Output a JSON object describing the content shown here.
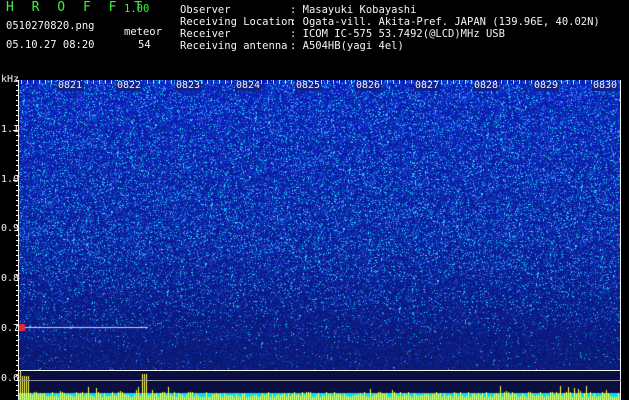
{
  "header": {
    "app_title": "H R O F F T",
    "app_version": "1.00",
    "file_name": "0510270820.png",
    "timestamp": "05.10.27 08:20",
    "meteor_label": "meteor",
    "meteor_count": "54"
  },
  "info": [
    {
      "key": "Observer",
      "value": ": Masayuki Kobayashi"
    },
    {
      "key": "Receiving Location",
      "value": ": Ogata-vill. Akita-Pref. JAPAN (139.96E, 40.02N)"
    },
    {
      "key": "Receiver",
      "value": ": ICOM IC-575 53.7492(@LCD)MHz USB"
    },
    {
      "key": "Receiving antenna",
      "value": ": A504HB(yagi 4el)"
    }
  ],
  "axis": {
    "unit": "kHz",
    "freq_ticks": [
      "1.1",
      "1.0",
      "0.9",
      "0.8",
      "0.7",
      "0.6"
    ],
    "time_ticks": [
      "0821",
      "0822",
      "0823",
      "0824",
      "0825",
      "0826",
      "0827",
      "0828",
      "0829",
      "0830"
    ]
  },
  "colors": {
    "label_green": "#3cf03c",
    "label_white": "#f4f4f4",
    "signal_yellow": "#ffff40",
    "spectrum_cyan": "#00e0ff",
    "background_blue": "#1e43c4"
  }
}
